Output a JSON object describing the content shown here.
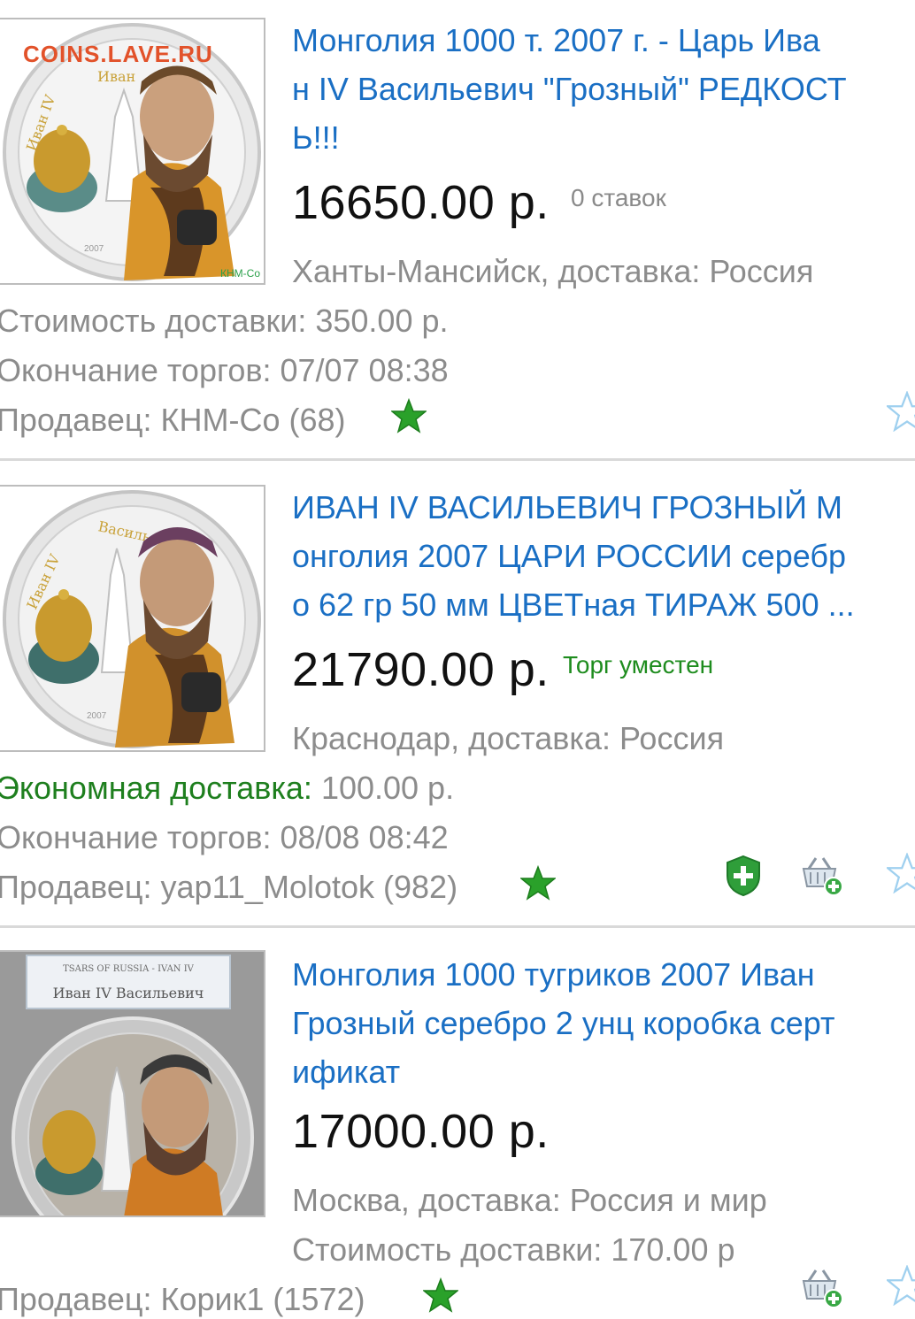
{
  "watermark": "COINS.LAVE.RU",
  "listings": [
    {
      "title_lines": [
        "Монголия 1000 т. 2007 г. - Царь Ива",
        "н IV Васильевич \"Грозный\" РЕДКОСТ",
        "Ь!!!"
      ],
      "price": "16650.00 р.",
      "bids": "0 ставок",
      "location": "Ханты-Мансийск, доставка: Россия",
      "shipping": "Стоимость доставки: 350.00 р.",
      "end": "Окончание торгов: 07/07 08:38",
      "seller": "Продавец: КНМ-Со (68)",
      "image_caption": "КНМ-Со"
    },
    {
      "title_lines": [
        "ИВАН IV ВАСИЛЬЕВИЧ ГРОЗНЫЙ М",
        "онголия 2007 ЦАРИ РОССИИ серебр",
        "о 62 гр 50 мм ЦВЕТная ТИРАЖ 500 ..."
      ],
      "price": "21790.00 р.",
      "haggle": "Торг уместен",
      "location": "Краснодар, доставка: Россия",
      "shipping_label": "Экономная доставка:",
      "shipping_value": " 100.00 р.",
      "end": "Окончание торгов: 08/08 08:42",
      "seller": "Продавец: yap11_Molotok (982)"
    },
    {
      "title_lines": [
        "Монголия 1000 тугриков 2007 Иван",
        "Грозный серебро 2 унц коробка серт",
        "ификат"
      ],
      "price": "17000.00 р.",
      "location": "Москва, доставка: Россия и мир",
      "shipping": "Стоимость доставки: 170.00 р",
      "seller": "Продавец: Корик1 (1572)",
      "box_label_top": "TSARS OF RUSSIA - IVAN IV",
      "box_label_main": "Иван IV Васильевич"
    }
  ],
  "colors": {
    "link": "#1a6fc4",
    "secondary": "#8c8c8c",
    "green": "#1e8c1e"
  }
}
